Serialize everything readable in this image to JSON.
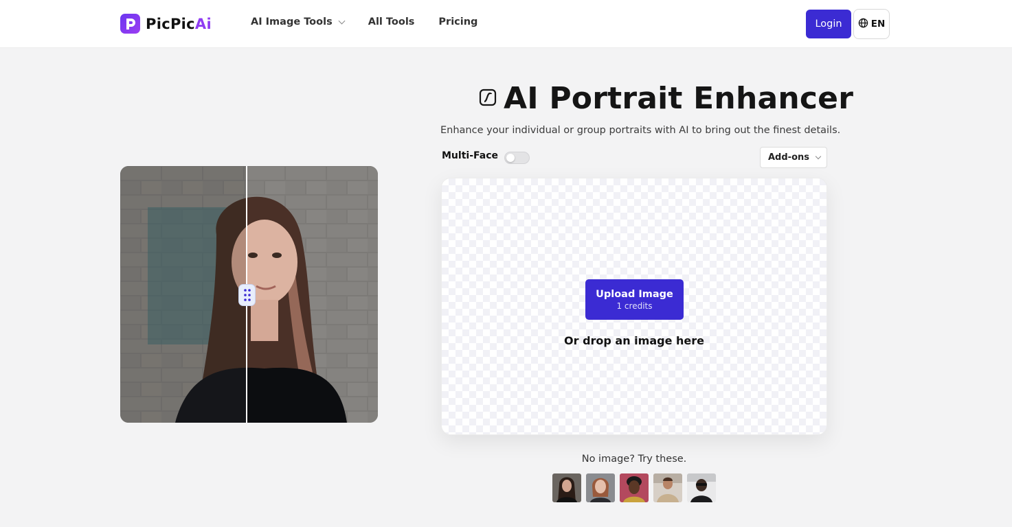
{
  "header": {
    "logo": {
      "text_main": "PicPic",
      "text_accent": "Ai",
      "icon": "logo-p-icon"
    },
    "nav": [
      {
        "label": "AI Image Tools",
        "has_dropdown": true
      },
      {
        "label": "All Tools",
        "has_dropdown": false
      },
      {
        "label": "Pricing",
        "has_dropdown": false
      }
    ],
    "login_label": "Login",
    "language": {
      "label": "EN",
      "icon": "globe-icon"
    }
  },
  "main": {
    "title_icon": "portrait-enhance-icon",
    "title": "AI Portrait Enhancer",
    "subtitle": "Enhance your individual or group portraits with AI to bring out the finest details.",
    "multi_face": {
      "label": "Multi-Face",
      "enabled": false
    },
    "addons_label": "Add-ons",
    "upload": {
      "button_label": "Upload Image",
      "credits_label": "1 credits",
      "drop_text": "Or drop an image here"
    },
    "try_text": "No image? Try these.",
    "samples": [
      "sample-portrait-1",
      "sample-portrait-2",
      "sample-portrait-3",
      "sample-portrait-4",
      "sample-portrait-5"
    ]
  },
  "colors": {
    "primary": "#3b2bd3",
    "logo_gradient_start": "#6a37f0",
    "logo_accent": "#8f3cf2",
    "page_bg": "#f3f3f4"
  }
}
